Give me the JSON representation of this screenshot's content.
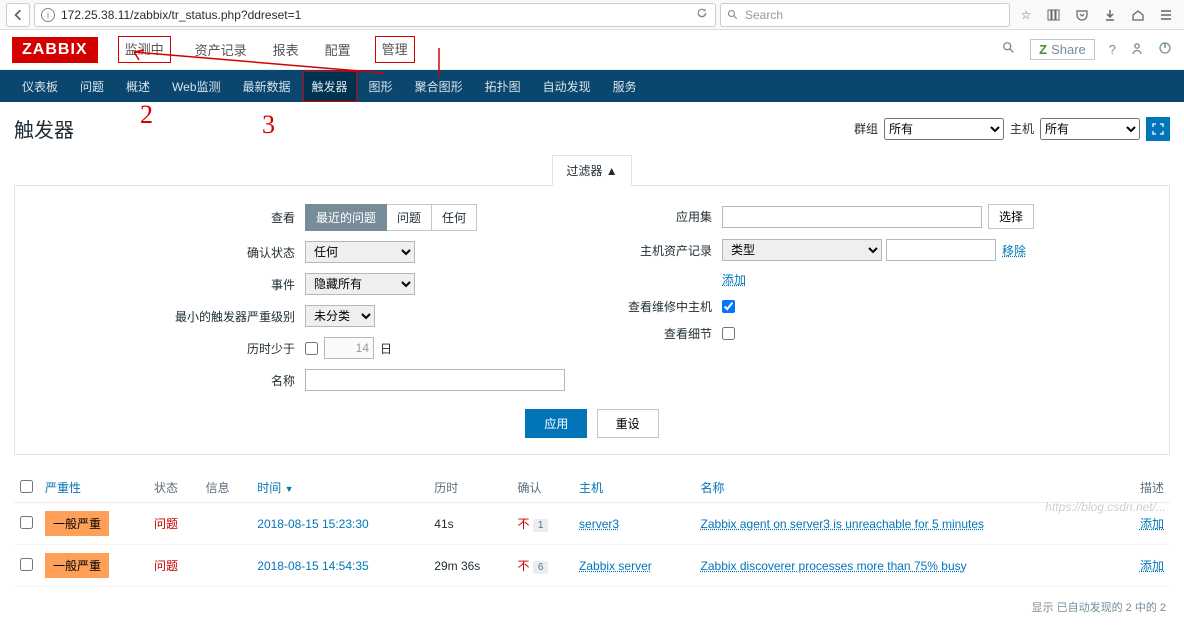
{
  "browser": {
    "url": "172.25.38.11/zabbix/tr_status.php?ddreset=1",
    "search_placeholder": "Search"
  },
  "top_menu": {
    "logo": "ZABBIX",
    "items": [
      "监测中",
      "资产记录",
      "报表",
      "配置",
      "管理"
    ],
    "share": "Share"
  },
  "sub_nav": [
    "仪表板",
    "问题",
    "概述",
    "Web监测",
    "最新数据",
    "触发器",
    "图形",
    "聚合图形",
    "拓扑图",
    "自动发现",
    "服务"
  ],
  "page_title": "触发器",
  "header_controls": {
    "group_label": "群组",
    "group_value": "所有",
    "host_label": "主机",
    "host_value": "所有"
  },
  "filter": {
    "tab": "过滤器 ▲",
    "view_label": "查看",
    "view_options": [
      "最近的问题",
      "问题",
      "任何"
    ],
    "ack_label": "确认状态",
    "ack_value": "任何",
    "event_label": "事件",
    "event_value": "隐藏所有",
    "min_sev_label": "最小的触发器严重级别",
    "min_sev_value": "未分类",
    "age_label": "历时少于",
    "age_value": "14",
    "age_unit": "日",
    "name_label": "名称",
    "app_label": "应用集",
    "app_select": "选择",
    "inv_label": "主机资产记录",
    "inv_value": "类型",
    "inv_remove": "移除",
    "inv_add": "添加",
    "maint_label": "查看维修中主机",
    "details_label": "查看细节",
    "apply": "应用",
    "reset": "重设"
  },
  "table": {
    "headers": {
      "checkbox": "",
      "severity": "严重性",
      "status": "状态",
      "info": "信息",
      "time": "时间",
      "duration": "历时",
      "ack": "确认",
      "host": "主机",
      "name": "名称",
      "desc": "描述"
    },
    "rows": [
      {
        "severity": "一般严重",
        "status": "问题",
        "time": "2018-08-15 15:23:30",
        "duration": "41s",
        "ack_label": "不",
        "ack_count": "1",
        "host": "server3",
        "name": "Zabbix agent on server3 is unreachable for 5 minutes",
        "add": "添加"
      },
      {
        "severity": "一般严重",
        "status": "问题",
        "time": "2018-08-15 14:54:35",
        "duration": "29m 36s",
        "ack_label": "不",
        "ack_count": "6",
        "host": "Zabbix server",
        "name": "Zabbix discoverer processes more than 75% busy",
        "add": "添加"
      }
    ]
  },
  "footer": "显示 已自动发现的 2 中的 2",
  "annotations": {
    "two": "2",
    "three": "3"
  },
  "watermark": "https://blog.csdn.net/..."
}
